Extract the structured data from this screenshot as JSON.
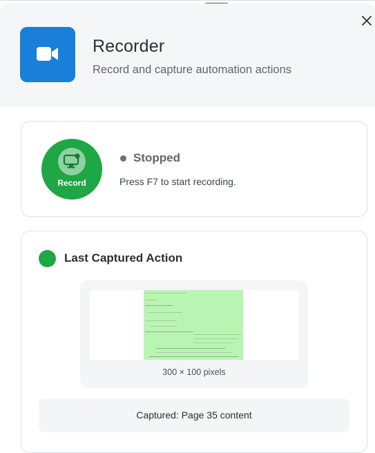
{
  "header": {
    "title": "Recorder",
    "subtitle": "Record and capture automation actions",
    "icon": "video-camera-icon",
    "accent_color": "#1a7fd8"
  },
  "status_card": {
    "record_label": "Record",
    "record_icon": "screen-record-icon",
    "record_color": "#1fa645",
    "state": "Stopped",
    "hint": "Press F7 to start recording."
  },
  "capture_card": {
    "title": "Last Captured Action",
    "indicator_color": "#1fa645",
    "preview_caption": "300 × 100 pixels",
    "captured_text": "Captured: Page 35 content"
  }
}
